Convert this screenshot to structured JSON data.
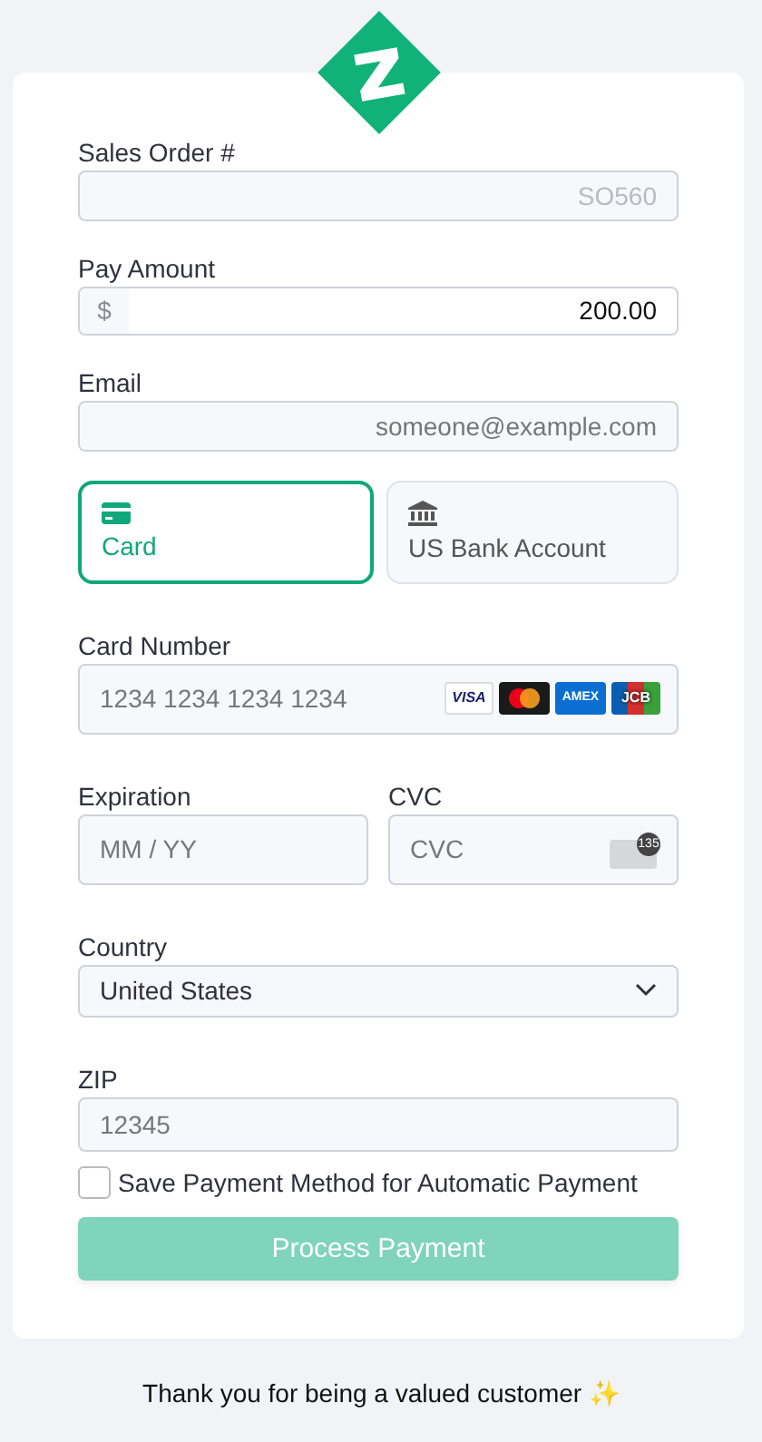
{
  "sales_order": {
    "label": "Sales Order #",
    "value": "SO560",
    "disabled": true
  },
  "pay_amount": {
    "label": "Pay Amount",
    "prefix": "$",
    "value": "200.00"
  },
  "email": {
    "label": "Email",
    "placeholder": "someone@example.com"
  },
  "payment_methods": [
    {
      "kind": "card",
      "label": "Card",
      "selected": true
    },
    {
      "kind": "bank",
      "label": "US Bank Account",
      "selected": false
    }
  ],
  "card_number": {
    "label": "Card Number",
    "placeholder": "1234 1234 1234 1234",
    "brands": [
      {
        "kind": "visa",
        "text": "VISA"
      },
      {
        "kind": "mastercard"
      },
      {
        "kind": "amex",
        "text": "AMEX"
      },
      {
        "kind": "jcb",
        "text": "JCB"
      }
    ]
  },
  "expiration": {
    "label": "Expiration",
    "placeholder": "MM / YY"
  },
  "cvc": {
    "label": "CVC",
    "placeholder": "CVC",
    "badge": "135"
  },
  "country": {
    "label": "Country",
    "value": "United States"
  },
  "zip": {
    "label": "ZIP",
    "placeholder": "12345"
  },
  "save_payment": {
    "label": "Save Payment Method for Automatic Payment",
    "checked": false
  },
  "submit": {
    "label": "Process Payment",
    "disabled": true
  },
  "footer": "Thank you for being a valued customer ✨"
}
